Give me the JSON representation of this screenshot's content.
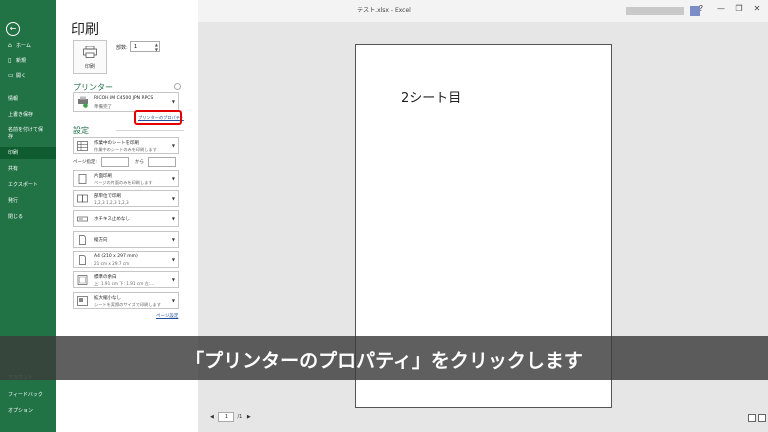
{
  "window": {
    "title": "テスト.xlsx - Excel",
    "controls": {
      "help": "?",
      "minimize": "—",
      "restore": "❐",
      "close": "✕"
    }
  },
  "sidebar": {
    "back_icon": "←",
    "items": [
      {
        "icon": "⌂",
        "label": "ホーム"
      },
      {
        "icon": "▯",
        "label": "新規"
      },
      {
        "icon": "▭",
        "label": "開く"
      },
      {
        "icon": "",
        "label": "情報"
      },
      {
        "icon": "",
        "label": "上書き保存"
      },
      {
        "icon": "",
        "label": "名前を付けて保"
      },
      {
        "icon": "",
        "label": "存"
      },
      {
        "icon": "",
        "label": "印刷"
      },
      {
        "icon": "",
        "label": "共有"
      },
      {
        "icon": "",
        "label": "エクスポート"
      },
      {
        "icon": "",
        "label": "発行"
      },
      {
        "icon": "",
        "label": "閉じる"
      }
    ],
    "account": "アカウント",
    "feedback": "フィードバック",
    "options": "オプション"
  },
  "print": {
    "heading": "印刷",
    "print_button": "印刷",
    "copies_label": "部数:",
    "copies_value": "1",
    "printer_section": "プリンター",
    "printer_name": "RICOH IM C4500 JPN RPCS",
    "printer_status": "準備完了",
    "printer_properties": "プリンターのプロパティ",
    "settings_section": "設定",
    "what_to_print": {
      "title": "作業中のシートを印刷",
      "sub": "作業中のシートのみを印刷します"
    },
    "pages_label": "ページ指定:",
    "pages_to": "から",
    "sides": {
      "title": "片面印刷",
      "sub": "ページの片面のみを印刷します"
    },
    "collation": {
      "title": "部単位で印刷",
      "sub": "1,2,3   1,2,3   1,2,3"
    },
    "staple": "ホチキス止めなし",
    "orientation": "縦方向",
    "paper": {
      "title": "A4 (210 x 297 mm)",
      "sub": "21 cm x 29.7 cm"
    },
    "margins": {
      "title": "標準の余白",
      "sub": "上: 1.91 cm 下: 1.91 cm 左:..."
    },
    "scaling": {
      "title": "拡大縮小なし",
      "sub": "シートを実際のサイズで印刷します"
    },
    "page_setup": "ページ設定"
  },
  "preview": {
    "page_text": "2シート目",
    "current_page": "1",
    "total_pages": "/1",
    "prev": "◀",
    "next": "▶"
  },
  "caption": "「プリンターのプロパティ」をクリックします",
  "colors": {
    "accent": "#217346",
    "highlight": "#e30000",
    "link": "#1f4e9e"
  }
}
